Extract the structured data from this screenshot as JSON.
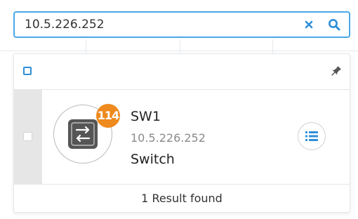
{
  "search": {
    "value": "10.5.226.252",
    "clear_icon": "close-icon",
    "search_icon": "search-icon"
  },
  "results": {
    "header": {
      "pin_icon": "pin-icon"
    },
    "items": [
      {
        "name": "SW1",
        "ip": "10.5.226.252",
        "type": "Switch",
        "badge_count": "114",
        "icon": "switch-icon"
      }
    ],
    "footer_text": "1 Result found"
  },
  "colors": {
    "accent": "#2f8fd8",
    "search_border": "#4aa8e6",
    "badge": "#ee8a1e",
    "selection_strip": "#e6e6e6"
  }
}
